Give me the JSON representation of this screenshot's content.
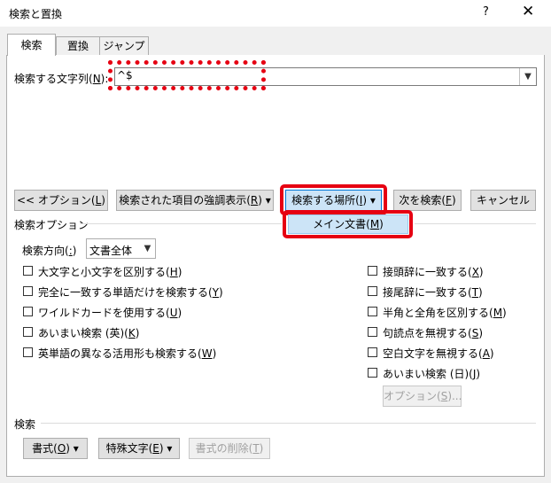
{
  "window": {
    "title": "検索と置換",
    "help": "?",
    "close": "✕"
  },
  "tabs": [
    "検索",
    "置換",
    "ジャンプ"
  ],
  "search": {
    "label_pre": "検索する文字列(",
    "label_key": "N",
    "label_post": "):",
    "value": "^$"
  },
  "buttons": {
    "options": {
      "pre": "<< オプション(",
      "key": "L",
      "post": ")"
    },
    "highlight": {
      "pre": "検索された項目の強調表示(",
      "key": "R",
      "post": ") ▾"
    },
    "find_in": {
      "pre": "検索する場所(",
      "key": "I",
      "post": ") ▾"
    },
    "find_next": {
      "pre": "次を検索(",
      "key": "F",
      "post": ")"
    },
    "cancel": "キャンセル"
  },
  "find_in_menu": {
    "pre": "メイン文書(",
    "key": "M",
    "post": ")"
  },
  "search_options": {
    "group_label": "検索オプション",
    "direction_label": {
      "pre": "検索方向(",
      "key": ":",
      "post": ")"
    },
    "direction_value": "文書全体"
  },
  "left_checks": [
    {
      "pre": "大文字と小文字を区別する(",
      "key": "H",
      "post": ")"
    },
    {
      "pre": "完全に一致する単語だけを検索する(",
      "key": "Y",
      "post": ")"
    },
    {
      "pre": "ワイルドカードを使用する(",
      "key": "U",
      "post": ")"
    },
    {
      "pre": "あいまい検索 (英)(",
      "key": "K",
      "post": ")"
    },
    {
      "pre": "英単語の異なる活用形も検索する(",
      "key": "W",
      "post": ")"
    }
  ],
  "right_checks": [
    {
      "pre": "接頭辞に一致する(",
      "key": "X",
      "post": ")"
    },
    {
      "pre": "接尾辞に一致する(",
      "key": "T",
      "post": ")"
    },
    {
      "pre": "半角と全角を区別する(",
      "key": "M",
      "post": ")"
    },
    {
      "pre": "句読点を無視する(",
      "key": "S",
      "post": ")"
    },
    {
      "pre": "空白文字を無視する(",
      "key": "A",
      "post": ")"
    },
    {
      "pre": "あいまい検索 (日)(",
      "key": "J",
      "post": ")"
    }
  ],
  "fuzzy_options_btn": {
    "pre": "オプション(",
    "key": "S",
    "post": ")..."
  },
  "bottom": {
    "group_label": "検索",
    "format": {
      "pre": "書式(",
      "key": "O",
      "post": ") ▾"
    },
    "special": {
      "pre": "特殊文字(",
      "key": "E",
      "post": ") ▾"
    },
    "clear": {
      "pre": "書式の削除(",
      "key": "T",
      "post": ")"
    }
  },
  "colors": {
    "accent": "#0078d7",
    "highlight_red": "#e60012",
    "button_blue": "#cce4f7"
  }
}
